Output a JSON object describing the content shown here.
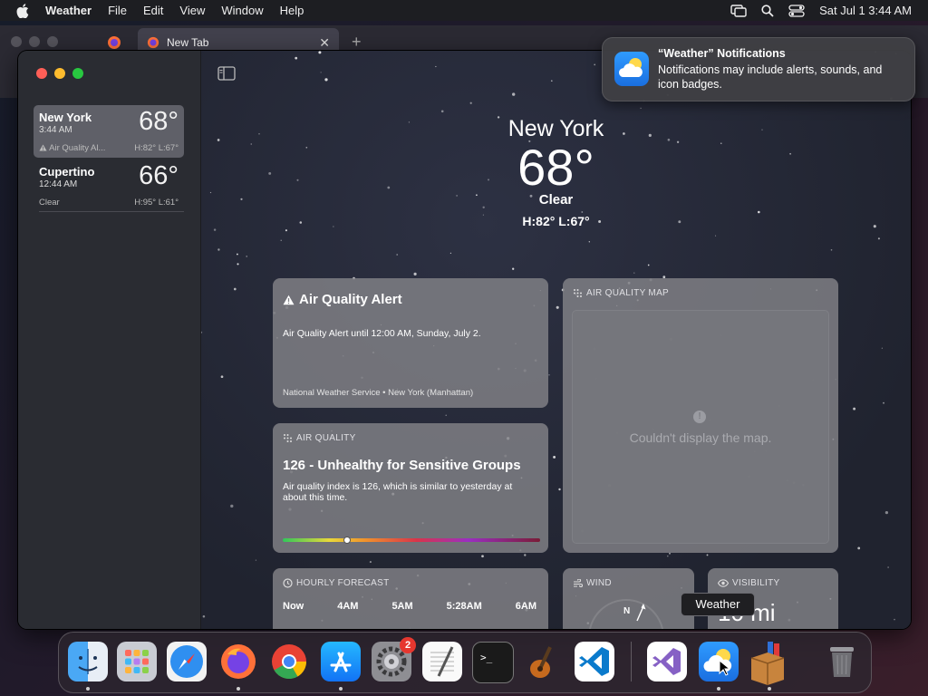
{
  "menubar": {
    "app_name": "Weather",
    "menus": [
      "File",
      "Edit",
      "View",
      "Window",
      "Help"
    ],
    "datetime": "Sat Jul 1  3:44 AM"
  },
  "browser": {
    "tab_title": "New Tab",
    "close_glyph": "✕",
    "new_tab_glyph": "+"
  },
  "sidebar": {
    "locations": [
      {
        "city": "New York",
        "time": "3:44 AM",
        "condition": "Air Quality Al...",
        "temp": "68°",
        "high_low": "H:82°  L:67°"
      },
      {
        "city": "Cupertino",
        "time": "12:44 AM",
        "condition": "Clear",
        "temp": "66°",
        "high_low": "H:95°  L:61°"
      }
    ]
  },
  "hero": {
    "city": "New York",
    "temp": "68°",
    "condition": "Clear",
    "high_low": "H:82°  L:67°"
  },
  "alert_card": {
    "title": "Air Quality Alert",
    "body": "Air Quality Alert until 12:00 AM, Sunday, July 2.",
    "source": "National Weather Service • New York (Manhattan)"
  },
  "map_card": {
    "header": "AIR QUALITY MAP",
    "info_glyph": "!",
    "message": "Couldn't display the map."
  },
  "aq_card": {
    "header": "AIR QUALITY",
    "value": "126 - Unhealthy for Sensitive Groups",
    "description": "Air quality index is 126, which is similar to yesterday at about this time.",
    "index_position": 0.25
  },
  "hourly_card": {
    "header": "HOURLY FORECAST",
    "hours": [
      "Now",
      "4AM",
      "5AM",
      "5:28AM",
      "6AM"
    ]
  },
  "wind_card": {
    "header": "WIND",
    "compass_label": "N"
  },
  "visibility_card": {
    "header": "VISIBILITY",
    "value": "10 mi"
  },
  "notification": {
    "title": "“Weather” Notifications",
    "body": "Notifications may include alerts, sounds, and icon badges."
  },
  "tooltip": {
    "text": "Weather"
  },
  "dock": {
    "apps": [
      "Finder",
      "Launchpad",
      "Safari",
      "Firefox",
      "Chrome",
      "App Store",
      "System Settings",
      "TextEdit",
      "Terminal",
      "GarageBand",
      "Visual Studio Code",
      "Visual Studio",
      "Weather",
      "Archive Utility",
      "Trash"
    ],
    "settings_badge": "2"
  },
  "colors": {
    "window_bg": "#272a38",
    "sidebar_bg": "#2a2c32",
    "card_bg": "#828388",
    "notification_icon": "#2f9bff"
  }
}
